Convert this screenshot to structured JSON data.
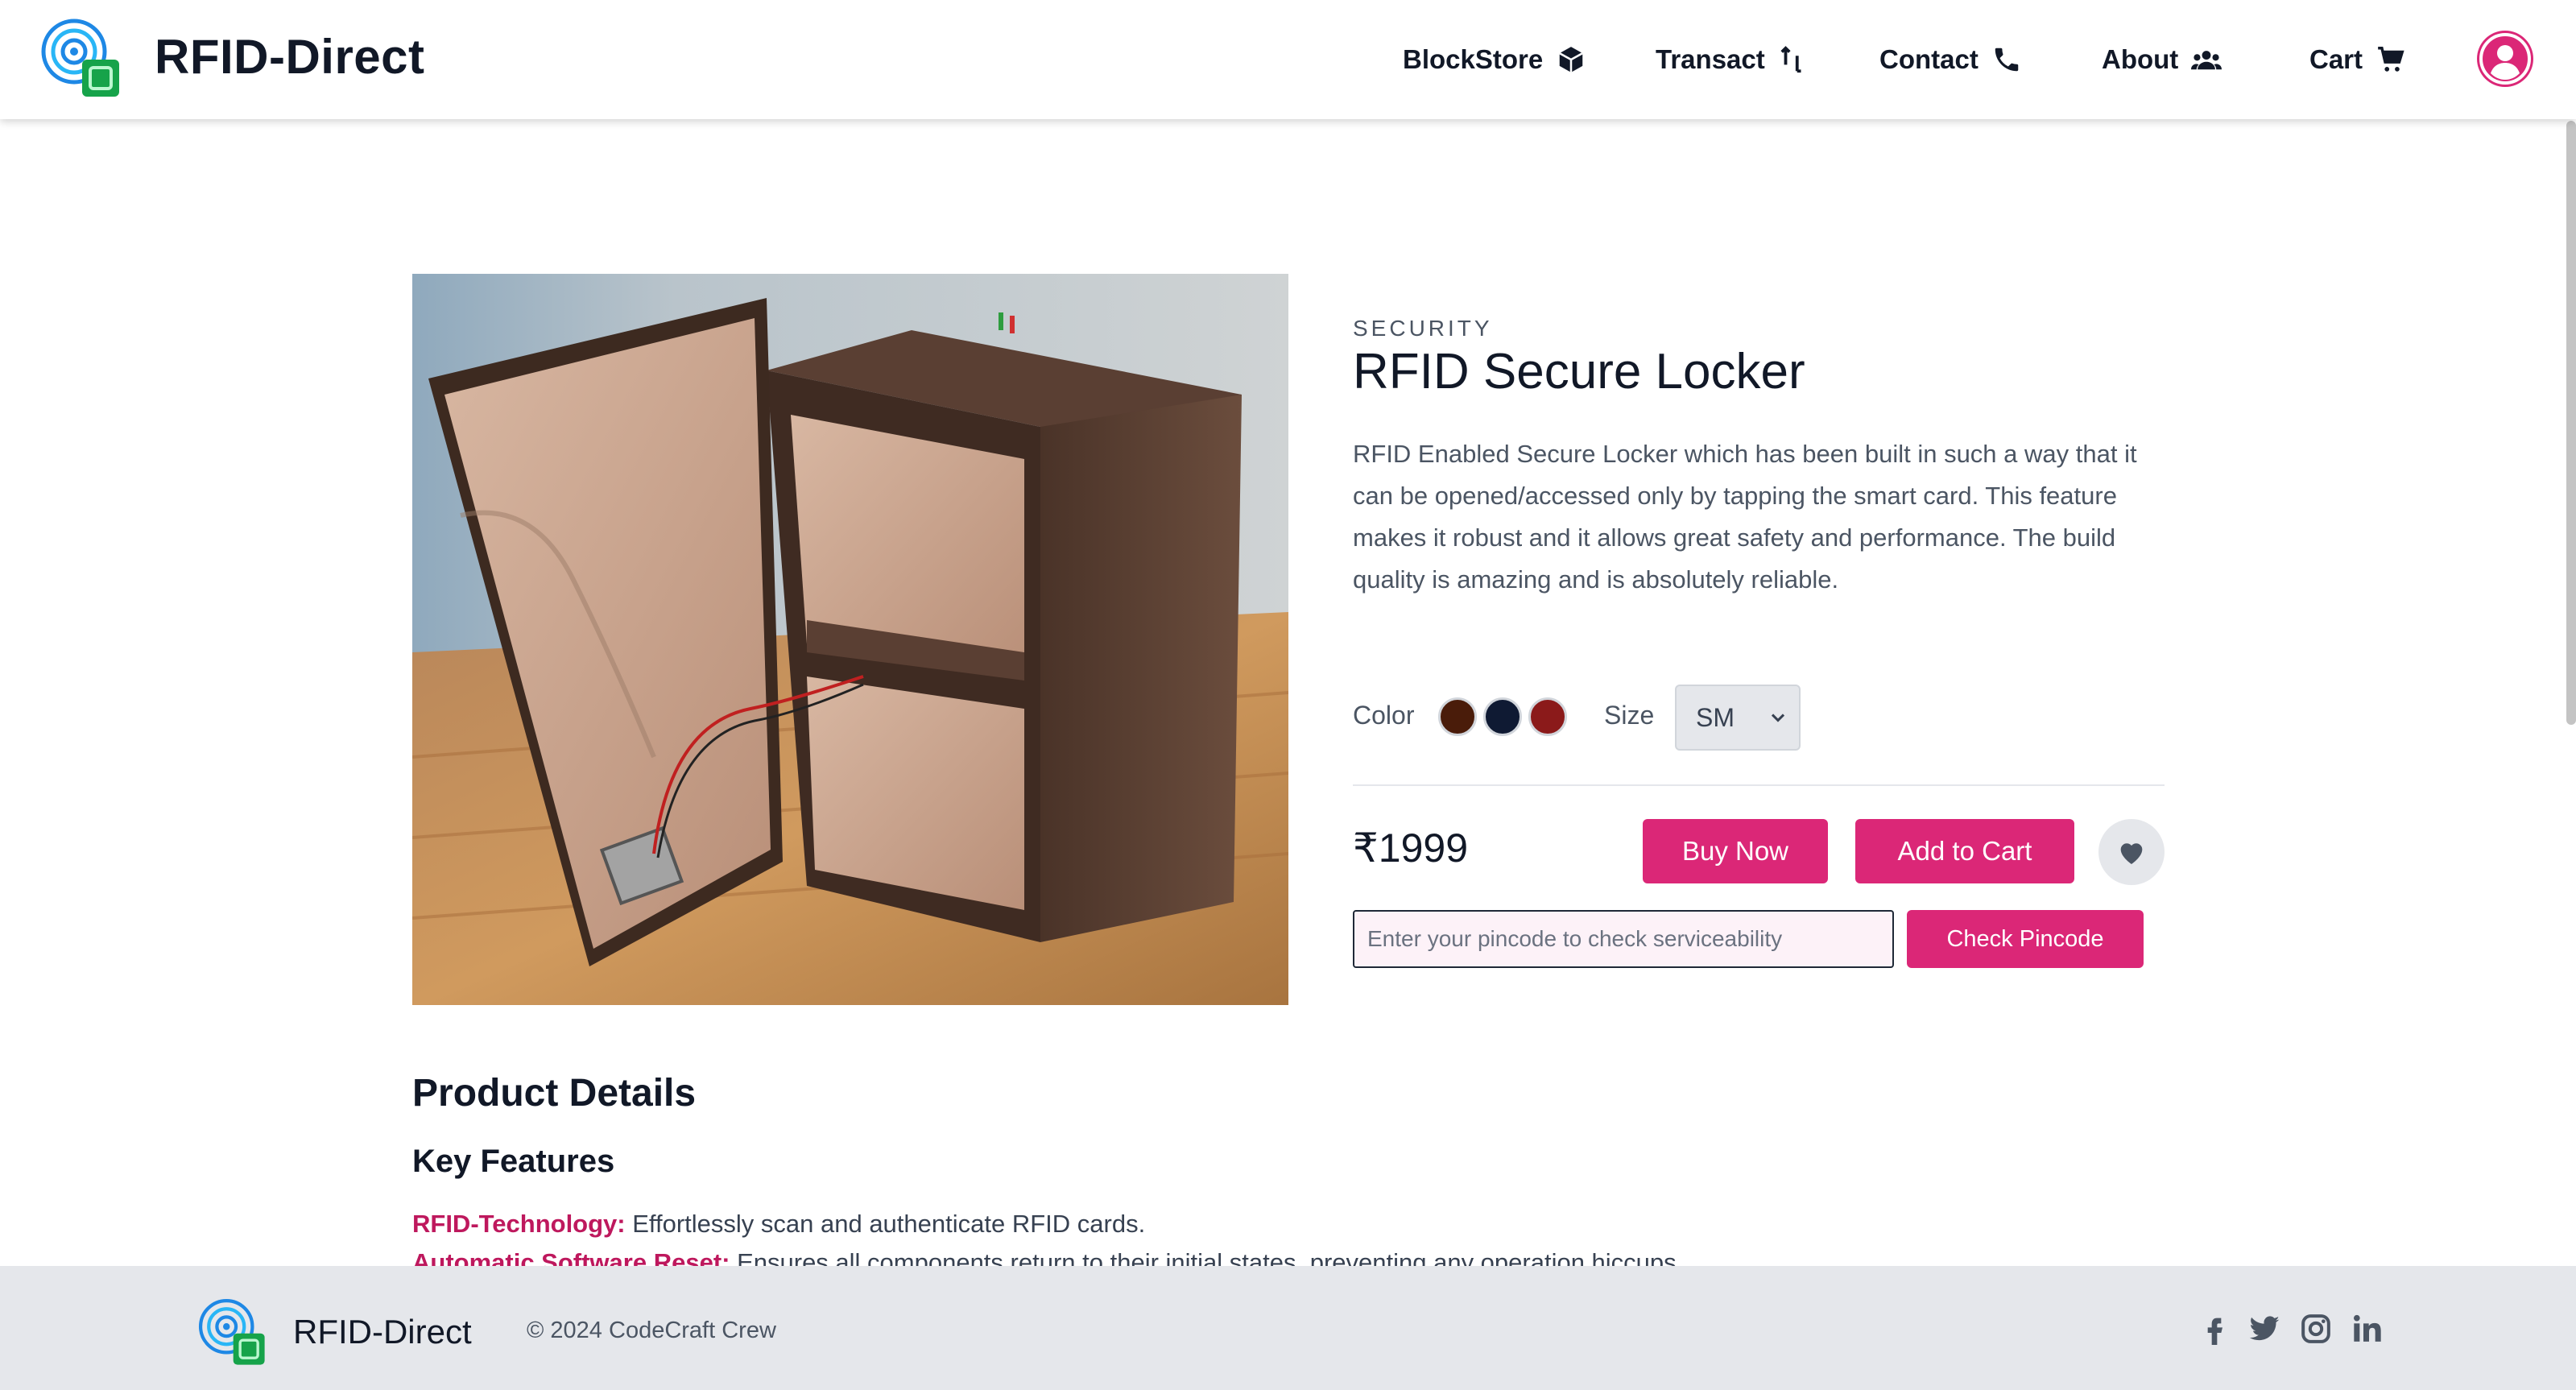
{
  "header": {
    "brand": "RFID-Direct",
    "nav": [
      {
        "label": "BlockStore",
        "icon": "cube-icon"
      },
      {
        "label": "Transact",
        "icon": "transfer-icon"
      },
      {
        "label": "Contact",
        "icon": "phone-icon"
      },
      {
        "label": "About",
        "icon": "users-icon"
      },
      {
        "label": "Cart",
        "icon": "cart-icon"
      }
    ],
    "avatar_icon": "user-circle-icon"
  },
  "product": {
    "category": "SECURITY",
    "title": "RFID Secure Locker",
    "description": "RFID Enabled Secure Locker which has been built in such a way that it can be opened/accessed only by tapping the smart card. This feature makes it robust and it allows great safety and performance. The build quality is amazing and is absolutely reliable.",
    "color_label": "Color",
    "colors": [
      "#4a1c0a",
      "#0f1a33",
      "#8b1a1a"
    ],
    "size_label": "Size",
    "size_value": "SM",
    "price": "₹1999",
    "buy_now": "Buy Now",
    "add_to_cart": "Add to Cart",
    "pincode_placeholder": "Enter your pincode to check serviceability",
    "check_pincode": "Check Pincode"
  },
  "details": {
    "title": "Product Details",
    "features_title": "Key Features",
    "features": [
      {
        "key": "RFID-Technology:",
        "text": " Effortlessly scan and authenticate RFID cards."
      },
      {
        "key": "Automatic Software Reset:",
        "text": " Ensures all components return to their initial states, preventing any operation hiccups."
      }
    ]
  },
  "footer": {
    "brand": "RFID-Direct",
    "copyright": "© 2024 CodeCraft Crew",
    "social": [
      "facebook-icon",
      "twitter-icon",
      "instagram-icon",
      "linkedin-icon"
    ]
  },
  "colors": {
    "accent": "#db2777",
    "footer_bg": "#e5e7eb"
  }
}
